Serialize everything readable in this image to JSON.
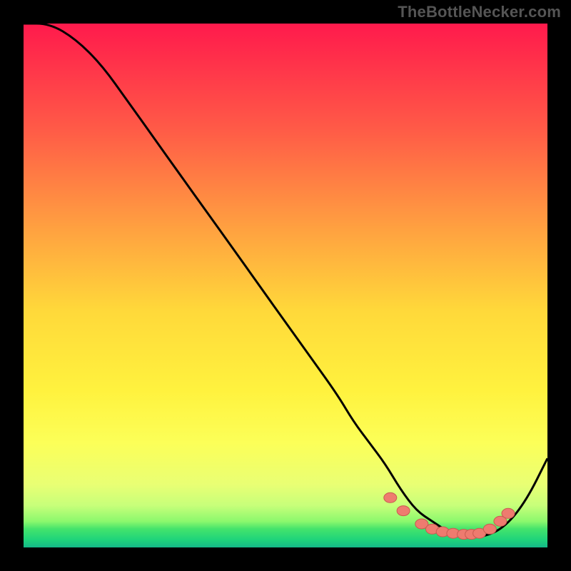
{
  "attribution": "TheBottleNecker.com",
  "colors": {
    "page_bg": "#000000",
    "curve": "#000000",
    "marker_fill": "#ee7b6f",
    "marker_stroke": "#c95a50",
    "gradient_stops": [
      {
        "offset": 0.0,
        "color": "#ff1a4c"
      },
      {
        "offset": 0.2,
        "color": "#ff5a47"
      },
      {
        "offset": 0.4,
        "color": "#ffa440"
      },
      {
        "offset": 0.55,
        "color": "#ffd93a"
      },
      {
        "offset": 0.7,
        "color": "#fff23e"
      },
      {
        "offset": 0.8,
        "color": "#fcff58"
      },
      {
        "offset": 0.88,
        "color": "#e9ff74"
      },
      {
        "offset": 0.92,
        "color": "#c7ff7a"
      },
      {
        "offset": 0.95,
        "color": "#8cf86d"
      },
      {
        "offset": 0.965,
        "color": "#43e36c"
      },
      {
        "offset": 0.985,
        "color": "#1fd47a"
      },
      {
        "offset": 1.0,
        "color": "#15b888"
      }
    ]
  },
  "chart_data": {
    "type": "line",
    "title": "",
    "xlabel": "",
    "ylabel": "",
    "xlim": [
      0,
      100
    ],
    "ylim": [
      0,
      100
    ],
    "legend": false,
    "grid": false,
    "series": [
      {
        "name": "curve",
        "x": [
          0,
          5,
          10,
          15,
          20,
          25,
          30,
          35,
          40,
          45,
          50,
          55,
          60,
          63,
          66,
          69,
          72,
          75,
          78,
          81,
          84,
          88,
          92,
          96,
          100
        ],
        "y": [
          100,
          100,
          97,
          92,
          85,
          78,
          71,
          64,
          57,
          50,
          43,
          36,
          29,
          24,
          20,
          16,
          11,
          7,
          5,
          3,
          2,
          2,
          4,
          9,
          17
        ]
      }
    ],
    "markers": {
      "name": "dots",
      "x": [
        70,
        72.5,
        76,
        78,
        80,
        82,
        84,
        85.5,
        87,
        89,
        91,
        92.5
      ],
      "y": [
        9.5,
        7.0,
        4.5,
        3.5,
        3.0,
        2.7,
        2.5,
        2.5,
        2.7,
        3.5,
        5.0,
        6.5
      ]
    }
  }
}
